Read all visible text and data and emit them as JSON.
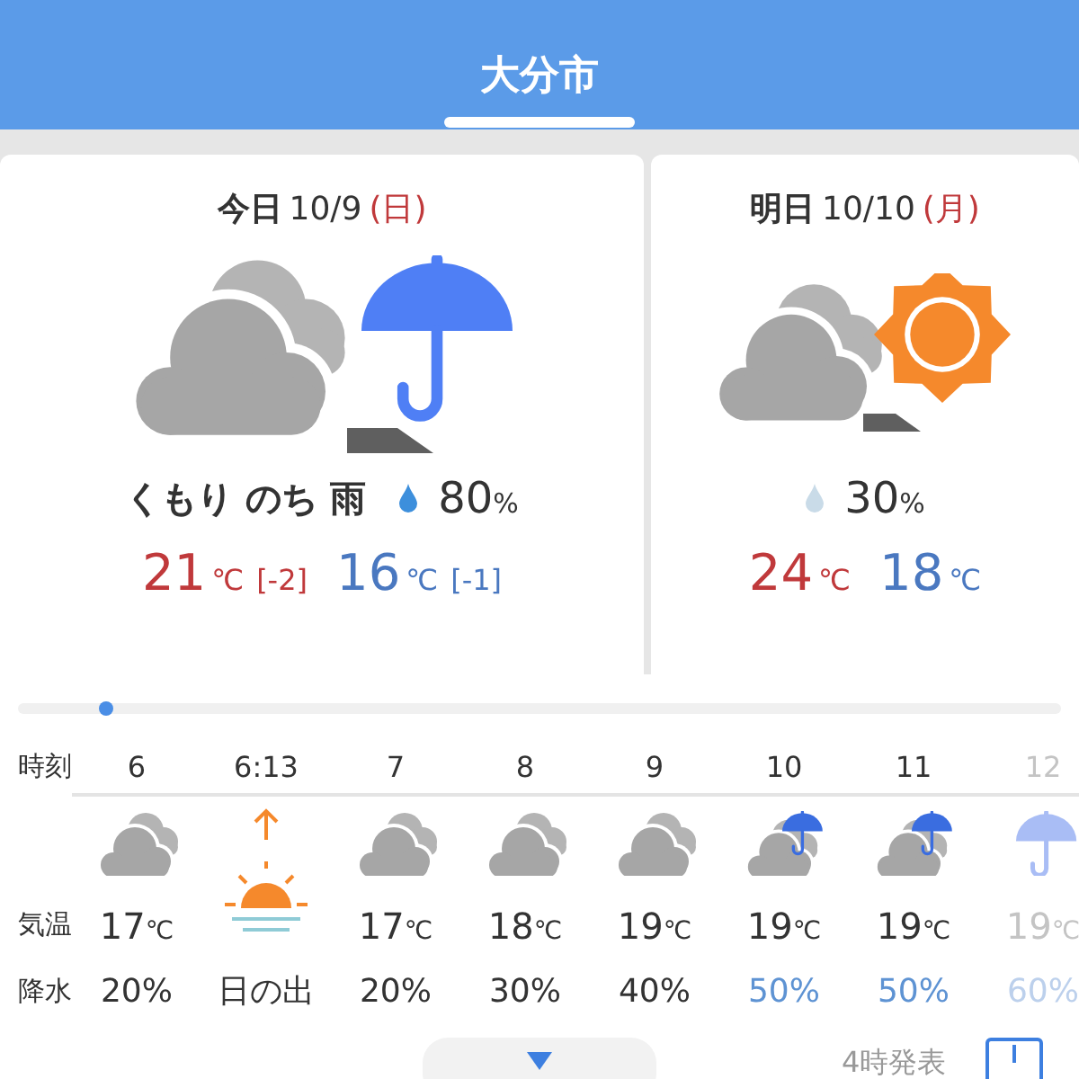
{
  "header": {
    "title": "大分市"
  },
  "days": [
    {
      "label": "今日",
      "date": "10/9",
      "weekday": "(日)",
      "kind": "cloud-then-rain",
      "weather": "くもり のち 雨",
      "color": "#3d8fdc",
      "precip": "80",
      "precip_unit": "%",
      "high": {
        "value": "21",
        "unit": "℃",
        "diff": "[-2]"
      },
      "low": {
        "value": "16",
        "unit": "℃",
        "diff": "[-1]"
      }
    },
    {
      "label": "明日",
      "date": "10/10",
      "weekday": "(月)",
      "kind": "cloud-then-sun",
      "color": "#c9dbe8",
      "precip": "30",
      "precip_unit": "%",
      "high": {
        "value": "24",
        "unit": "℃"
      },
      "low": {
        "value": "18",
        "unit": "℃"
      }
    }
  ],
  "hourly": {
    "labels": {
      "time": "時刻",
      "temp": "気温",
      "precip": "降水"
    },
    "hours": [
      {
        "kind": "cloud",
        "time": "6",
        "temp": "17",
        "unit": "℃",
        "precip": "20%",
        "color": "#333333"
      },
      {
        "kind": "sunrise",
        "time": "6:13",
        "precip": "日の出",
        "color": "#333333"
      },
      {
        "kind": "cloud",
        "time": "7",
        "temp": "17",
        "unit": "℃",
        "precip": "20%",
        "color": "#333333"
      },
      {
        "kind": "cloud",
        "time": "8",
        "temp": "18",
        "unit": "℃",
        "precip": "30%",
        "color": "#333333"
      },
      {
        "kind": "cloud",
        "time": "9",
        "temp": "19",
        "unit": "℃",
        "precip": "40%",
        "color": "#333333"
      },
      {
        "kind": "cloud-rain",
        "time": "10",
        "temp": "19",
        "unit": "℃",
        "precip": "50%",
        "color": "#5e93d3"
      },
      {
        "kind": "cloud-rain",
        "time": "11",
        "temp": "19",
        "unit": "℃",
        "precip": "50%",
        "color": "#5e93d3"
      },
      {
        "kind": "rain",
        "time": "12",
        "temp": "19",
        "unit": "℃",
        "precip": "60%",
        "color": "#bcd0ec"
      }
    ]
  },
  "footer": {
    "issued": "4時発表"
  }
}
